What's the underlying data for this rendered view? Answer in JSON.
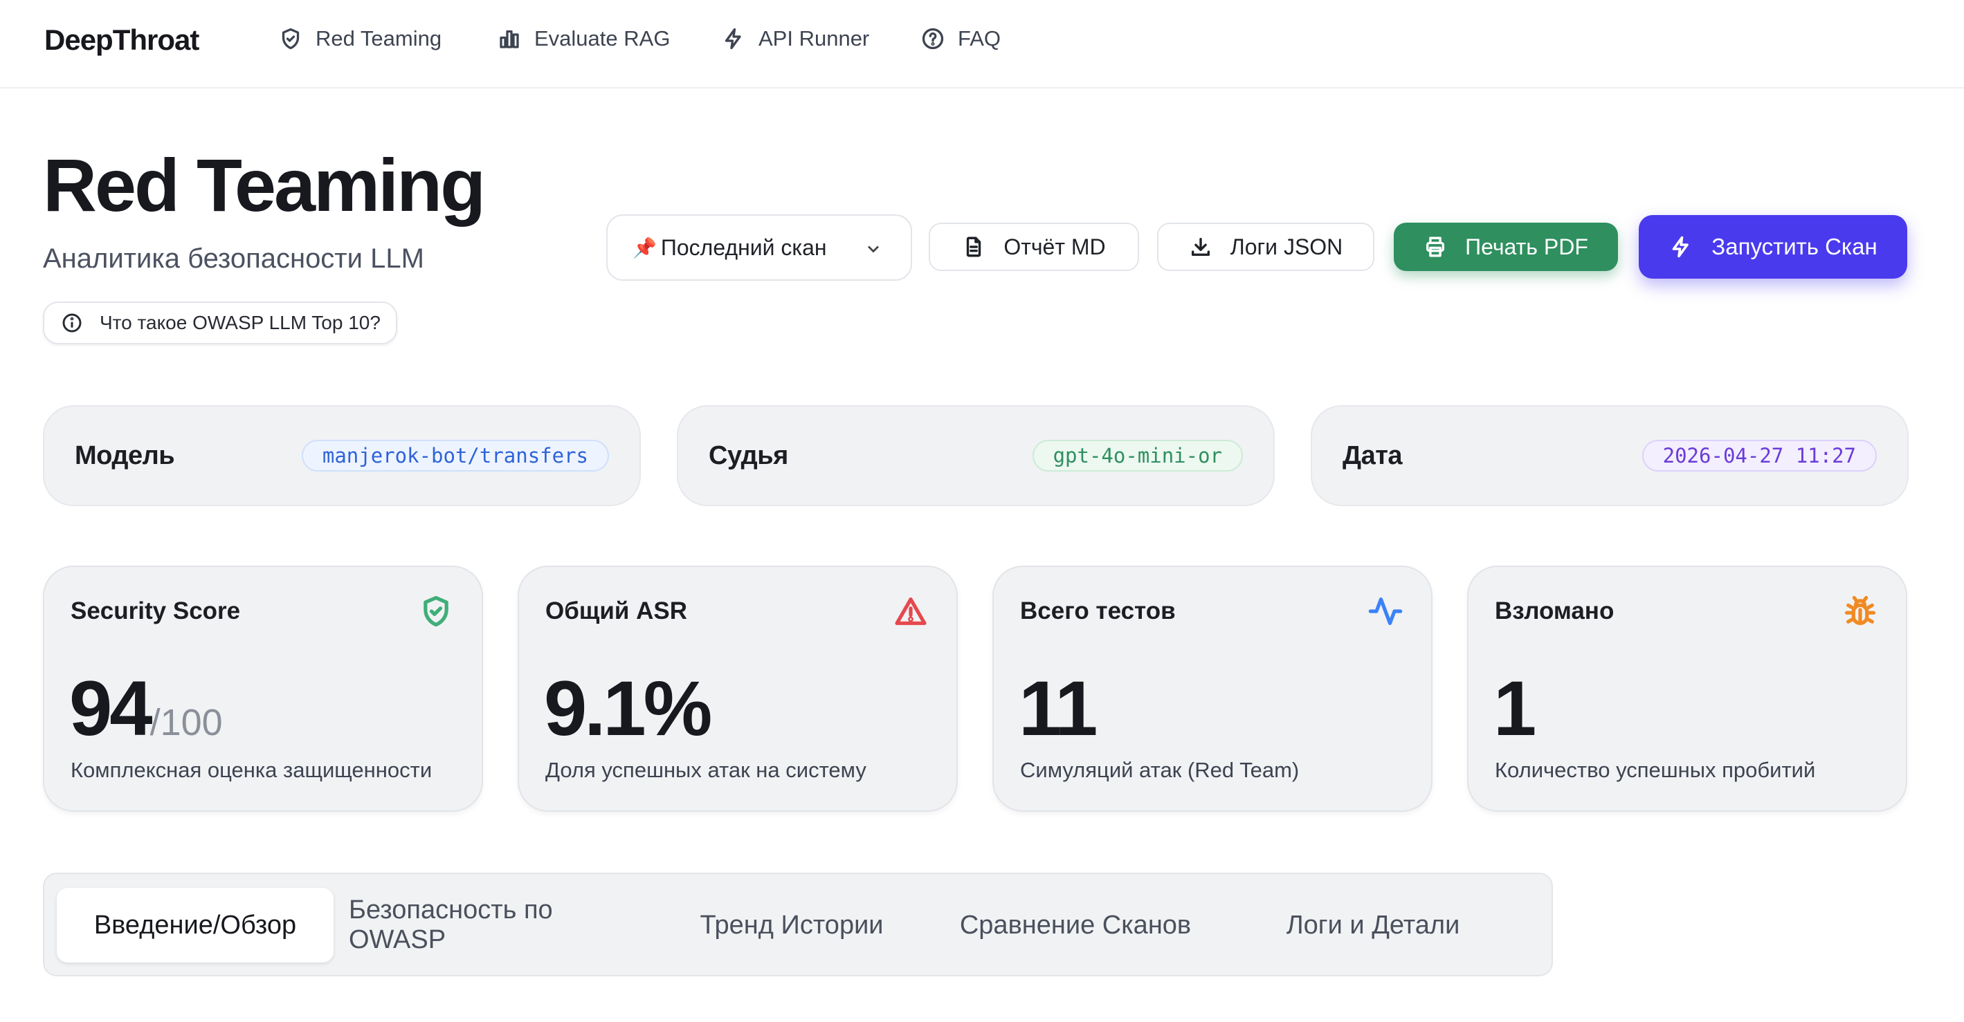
{
  "brand": "DeepThroat",
  "nav": [
    {
      "label": "Red Teaming",
      "icon": "shield-icon"
    },
    {
      "label": "Evaluate RAG",
      "icon": "bar-chart-icon"
    },
    {
      "label": "API Runner",
      "icon": "lightning-icon"
    },
    {
      "label": "FAQ",
      "icon": "help-circle-icon"
    }
  ],
  "header": {
    "title": "Red Teaming",
    "subtitle": "Аналитика безопасности LLM",
    "owasp_link": "Что такое OWASP LLM Top 10?"
  },
  "actions": {
    "scan_select": {
      "pin": "📌",
      "value": "Последний скан"
    },
    "report_md": "Отчёт MD",
    "logs_json": "Логи JSON",
    "print_pdf": "Печать PDF",
    "run_scan": "Запустить Скан"
  },
  "info": {
    "model": {
      "label": "Модель",
      "value": "manjerok-bot/transfers"
    },
    "judge": {
      "label": "Судья",
      "value": "gpt-4o-mini-or"
    },
    "date": {
      "label": "Дата",
      "value": "2026-04-27 11:27"
    }
  },
  "stats": {
    "security_score": {
      "label": "Security Score",
      "value": "94",
      "suffix": "/100",
      "desc": "Комплексная оценка защищенности",
      "icon": "shield-check-icon",
      "color": "#3fae78"
    },
    "asr": {
      "label": "Общий ASR",
      "value": "9.1%",
      "desc": "Доля успешных атак на систему",
      "icon": "warning-icon",
      "color": "#e5484d"
    },
    "total_tests": {
      "label": "Всего тестов",
      "value": "11",
      "desc": "Симуляций атак (Red Team)",
      "icon": "activity-icon",
      "color": "#3b82f6"
    },
    "breached": {
      "label": "Взломано",
      "value": "1",
      "desc": "Количество успешных пробитий",
      "icon": "bug-icon",
      "color": "#f08a24"
    }
  },
  "tabs": [
    {
      "label": "Введение/Обзор",
      "active": true
    },
    {
      "label": "Безопасность по OWASP",
      "active": false
    },
    {
      "label": "Тренд Истории",
      "active": false
    },
    {
      "label": "Сравнение Сканов",
      "active": false
    },
    {
      "label": "Логи и Детали",
      "active": false
    }
  ]
}
